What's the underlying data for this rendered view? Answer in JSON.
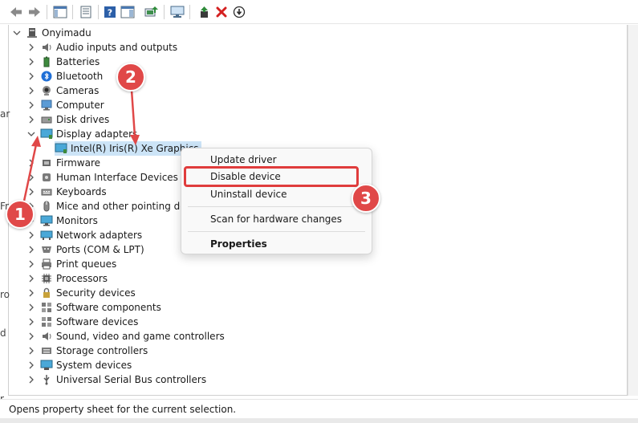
{
  "tree": {
    "root_label": "Onyimadu",
    "categories": [
      {
        "label": "Audio inputs and outputs",
        "icon": "speaker-icon"
      },
      {
        "label": "Batteries",
        "icon": "battery-icon"
      },
      {
        "label": "Bluetooth",
        "icon": "bluetooth-icon"
      },
      {
        "label": "Cameras",
        "icon": "camera-icon"
      },
      {
        "label": "Computer",
        "icon": "computer-icon"
      },
      {
        "label": "Disk drives",
        "icon": "disk-drive-icon"
      },
      {
        "label": "Display adapters",
        "icon": "display-adapter-icon",
        "expanded": true
      },
      {
        "label": "Firmware",
        "icon": "firmware-icon"
      },
      {
        "label": "Human Interface Devices",
        "icon": "hid-icon"
      },
      {
        "label": "Keyboards",
        "icon": "keyboard-icon"
      },
      {
        "label": "Mice and other pointing devi",
        "icon": "mouse-icon"
      },
      {
        "label": "Monitors",
        "icon": "monitor-icon"
      },
      {
        "label": "Network adapters",
        "icon": "network-adapter-icon"
      },
      {
        "label": "Ports (COM & LPT)",
        "icon": "port-icon"
      },
      {
        "label": "Print queues",
        "icon": "printer-icon"
      },
      {
        "label": "Processors",
        "icon": "processor-icon"
      },
      {
        "label": "Security devices",
        "icon": "security-device-icon"
      },
      {
        "label": "Software components",
        "icon": "software-component-icon"
      },
      {
        "label": "Software devices",
        "icon": "software-device-icon"
      },
      {
        "label": "Sound, video and game controllers",
        "icon": "sound-controller-icon"
      },
      {
        "label": "Storage controllers",
        "icon": "storage-controller-icon"
      },
      {
        "label": "System devices",
        "icon": "system-device-icon"
      },
      {
        "label": "Universal Serial Bus controllers",
        "icon": "usb-controller-icon"
      }
    ],
    "selected_device": "Intel(R) Iris(R) Xe Graphics"
  },
  "context_menu": {
    "items": [
      "Update driver",
      "Disable device",
      "Uninstall device",
      "Scan for hardware changes",
      "Properties"
    ]
  },
  "badges": [
    "1",
    "2",
    "3"
  ],
  "background_fragments": [
    "ar",
    "Fr",
    "ro",
    "d",
    "r"
  ],
  "status_bar": {
    "text": "Opens property sheet for the current selection."
  },
  "colors": {
    "selection": "#cce4f7",
    "annotation_red": "#e04848",
    "highlight_border": "#e03c3c",
    "delete_red": "#d42020",
    "enable_green": "#2e8b3a"
  },
  "toolbar_icons": [
    "back-arrow-icon",
    "forward-arrow-icon",
    "show-hide-console-tree-icon",
    "properties-icon",
    "help-icon",
    "action-pane-icon",
    "update-driver-icon",
    "scan-hardware-icon",
    "enable-device-icon",
    "uninstall-device-icon",
    "disable-device-icon"
  ]
}
